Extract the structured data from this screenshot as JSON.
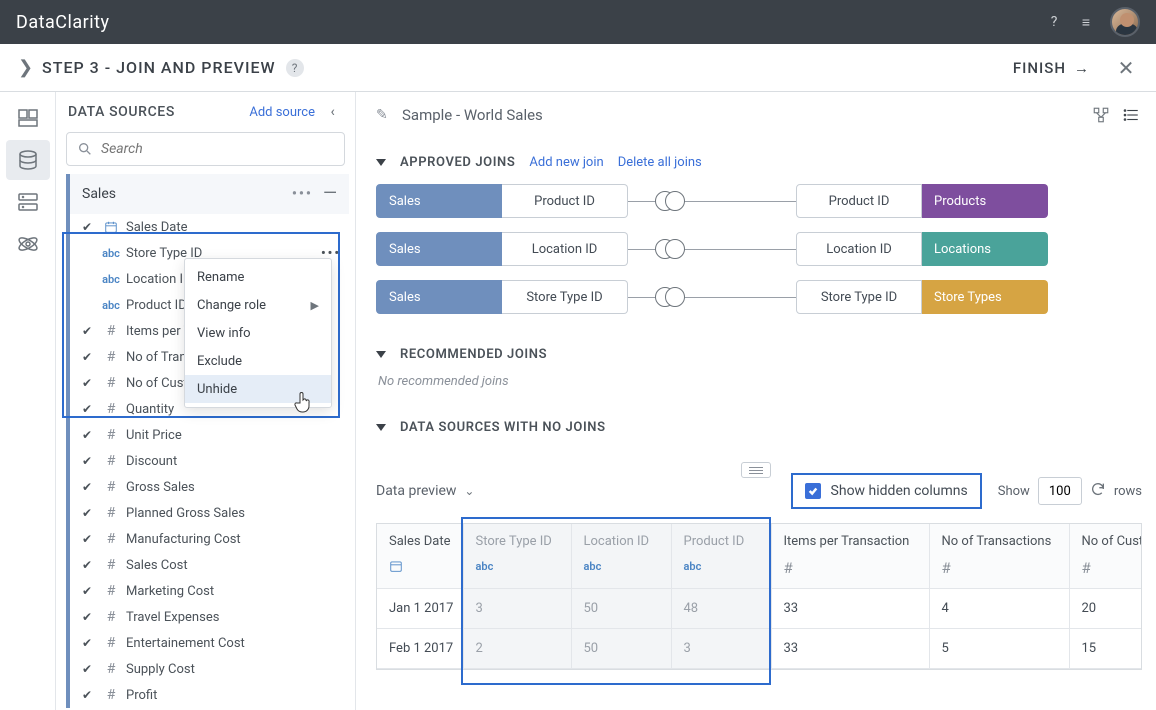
{
  "header": {
    "brand": "DataClarity",
    "help": "?",
    "menu": "≡"
  },
  "subheader": {
    "title": "STEP 3 - JOIN AND PREVIEW",
    "help": "?",
    "finish": "FINISH"
  },
  "sidebar": {
    "title": "DATA SOURCES",
    "add": "Add source",
    "search_placeholder": "Search",
    "ds_name": "Sales",
    "columns": [
      {
        "check": true,
        "type": "date",
        "label": "Sales Date"
      },
      {
        "check": false,
        "type": "abc",
        "label": "Store Type ID",
        "dots": true
      },
      {
        "check": false,
        "type": "abc",
        "label": "Location ID"
      },
      {
        "check": false,
        "type": "abc",
        "label": "Product ID"
      },
      {
        "check": true,
        "type": "hash",
        "label": "Items per Transaction"
      },
      {
        "check": true,
        "type": "hash",
        "label": "No of Transactions"
      },
      {
        "check": true,
        "type": "hash",
        "label": "No of Customers"
      },
      {
        "check": true,
        "type": "hash",
        "label": "Quantity"
      },
      {
        "check": true,
        "type": "hash",
        "label": "Unit Price"
      },
      {
        "check": true,
        "type": "hash",
        "label": "Discount"
      },
      {
        "check": true,
        "type": "hash",
        "label": "Gross Sales"
      },
      {
        "check": true,
        "type": "hash",
        "label": "Planned Gross Sales"
      },
      {
        "check": true,
        "type": "hash",
        "label": "Manufacturing Cost"
      },
      {
        "check": true,
        "type": "hash",
        "label": "Sales Cost"
      },
      {
        "check": true,
        "type": "hash",
        "label": "Marketing Cost"
      },
      {
        "check": true,
        "type": "hash",
        "label": "Travel Expenses"
      },
      {
        "check": true,
        "type": "hash",
        "label": "Entertainement Cost"
      },
      {
        "check": true,
        "type": "hash",
        "label": "Supply Cost"
      },
      {
        "check": true,
        "type": "hash",
        "label": "Profit"
      }
    ]
  },
  "ctx": {
    "rename": "Rename",
    "change_role": "Change role",
    "view_info": "View info",
    "exclude": "Exclude",
    "unhide": "Unhide"
  },
  "content": {
    "title": "Sample - World Sales",
    "approved": "APPROVED JOINS",
    "add_join": "Add new join",
    "delete_joins": "Delete all joins",
    "joins": [
      {
        "left_ds": "Sales",
        "left_col": "Product ID",
        "right_col": "Product ID",
        "right_ds": "Products",
        "color": "purple"
      },
      {
        "left_ds": "Sales",
        "left_col": "Location ID",
        "right_col": "Location ID",
        "right_ds": "Locations",
        "color": "teal"
      },
      {
        "left_ds": "Sales",
        "left_col": "Store Type ID",
        "right_col": "Store Type ID",
        "right_ds": "Store Types",
        "color": "gold"
      }
    ],
    "recommended": "RECOMMENDED JOINS",
    "no_rec": "No recommended joins",
    "no_joins_hdr": "DATA SOURCES WITH NO JOINS",
    "preview": "Data preview",
    "show_hidden": "Show hidden columns",
    "show_label": "Show",
    "show_value": "100",
    "rows_label": "rows",
    "table": {
      "headers": [
        {
          "label": "Sales Date",
          "type": "date",
          "hidden": false
        },
        {
          "label": "Store Type ID",
          "type": "abc",
          "hidden": true
        },
        {
          "label": "Location ID",
          "type": "abc",
          "hidden": true
        },
        {
          "label": "Product ID",
          "type": "abc",
          "hidden": true
        },
        {
          "label": "Items per Transaction",
          "type": "hash",
          "hidden": false
        },
        {
          "label": "No of Transactions",
          "type": "hash",
          "hidden": false
        },
        {
          "label": "No of Customers",
          "type": "hash",
          "hidden": false
        }
      ],
      "rows": [
        [
          "Jan 1 2017",
          "3",
          "50",
          "48",
          "33",
          "4",
          "20"
        ],
        [
          "Feb 1 2017",
          "2",
          "50",
          "3",
          "33",
          "5",
          "15"
        ]
      ]
    }
  }
}
